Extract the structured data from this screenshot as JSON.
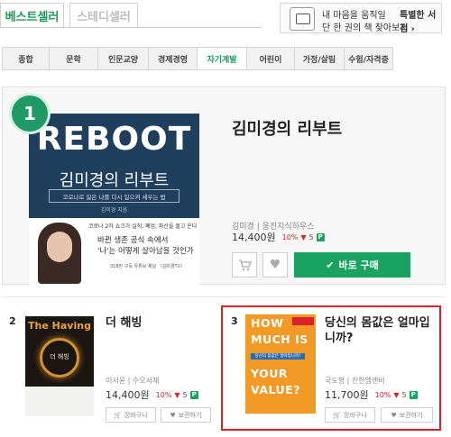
{
  "top_tabs": {
    "best": "베스트셀러",
    "steady": "스테디셀러"
  },
  "banner": {
    "line1": "내 마음을 움직일",
    "line2": "단 한 권의 책 찾아보기",
    "link": "특별한 서점 ›",
    "icon": "book-stand-icon"
  },
  "categories": [
    {
      "label": "종합",
      "active": false
    },
    {
      "label": "문학",
      "active": false
    },
    {
      "label": "인문교양",
      "active": false
    },
    {
      "label": "경제경영",
      "active": false
    },
    {
      "label": "자기계발",
      "active": true
    },
    {
      "label": "어린이",
      "active": false
    },
    {
      "label": "가정/살림",
      "active": false
    },
    {
      "label": "수험/자격증",
      "active": false
    }
  ],
  "featured": {
    "rank": "1",
    "title": "김미경의 리부트",
    "meta": "김미경 | 웅진지식하우스",
    "price": "14,400원",
    "discount": "10%",
    "points": "5",
    "buy_label": "바로 구매",
    "cover": {
      "title": "REBOOT",
      "subtitle": "김미경의 리부트",
      "tagline": "코로나로 잃은 나를 다시 일으켜 세우는 법",
      "author": "김미경 지음",
      "blurb1": "코로나 2차 쇼크가 실직, 폐업, 파산을 몰고 온다",
      "blurb2": "바뀐 생존 공식 속에서",
      "blurb3": "'나'는 어떻게 살아남을 것인가",
      "blurb4": "318만 구독 유튜브 채널 〈김미경TV〉"
    }
  },
  "cards": [
    {
      "rank": "2",
      "title": "더 해빙",
      "meta": "이서윤 | 수오서재",
      "price": "14,400원",
      "discount": "10%",
      "points": "5",
      "cart_label": "장바구니",
      "wish_label": "보관하기",
      "cover": {
        "title": "The Having",
        "kr": "더 해빙"
      }
    },
    {
      "rank": "3",
      "title": "당신의 몸값은 얼마입니까?",
      "title_line1": "당신의 몸값은 얼마입",
      "title_line2": "니까?",
      "meta": "국도형 | 진한엠앤비",
      "price": "11,700원",
      "discount": "10%",
      "points": "5",
      "cart_label": "장바구니",
      "wish_label": "보관하기",
      "cover": {
        "l1": "HOW",
        "l2": "MUCH IS",
        "l3": "YOUR",
        "l4": "VALUE?",
        "strip": "당신의 몸값은 얼마입니까?"
      }
    }
  ],
  "colors": {
    "accent": "#1aa260",
    "discount": "#d8232a",
    "highlight": "#d8232a"
  }
}
